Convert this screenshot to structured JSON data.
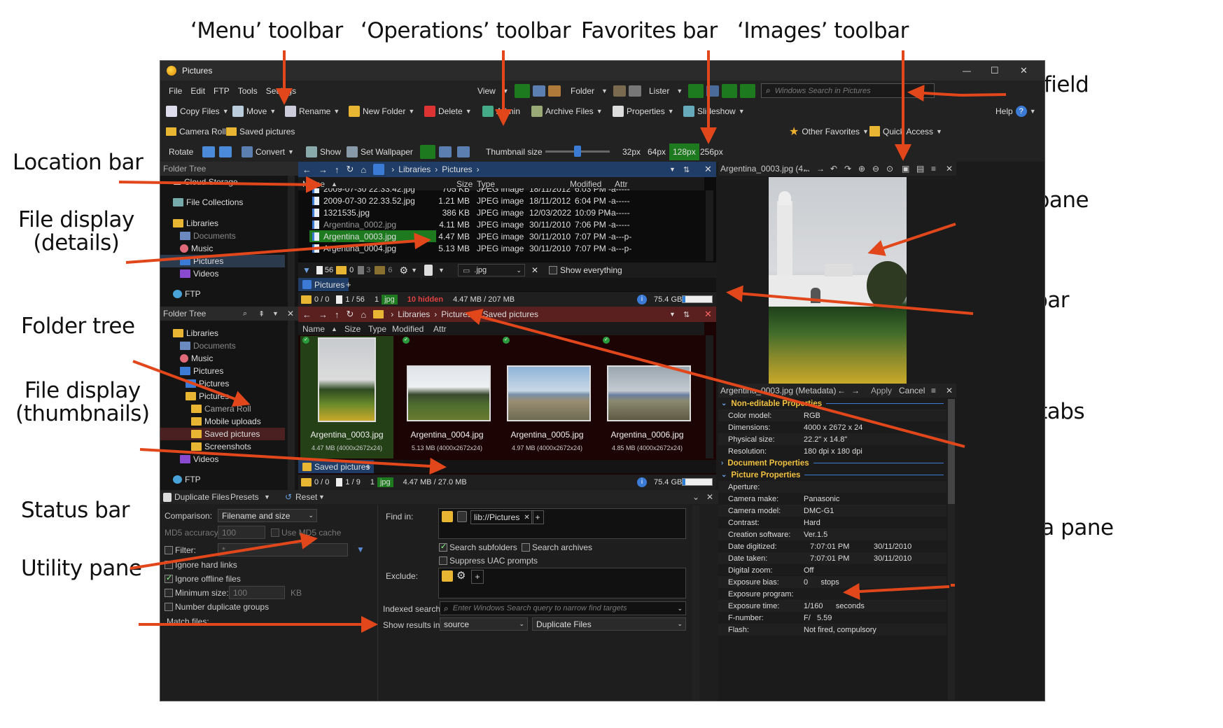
{
  "callouts": {
    "menu_toolbar": "‘Menu’ toolbar",
    "operations_toolbar": "‘Operations’ toolbar",
    "favorites_bar": "Favorites bar",
    "images_toolbar": "‘Images’ toolbar",
    "search_field": "Search field",
    "location_bar": "Location bar",
    "file_display_details_1": "File display",
    "file_display_details_2": "(details)",
    "viewer_pane": "Viewer pane",
    "filter_bar": "Filter bar",
    "folder_tree": "Folder tree",
    "file_display_thumbs_1": "File display",
    "file_display_thumbs_2": "(thumbnails)",
    "folder_tabs": "Folder tabs",
    "status_bar": "Status bar",
    "metadata_pane": "Metadata pane",
    "utility_pane": "Utility pane"
  },
  "window": {
    "title": "Pictures",
    "min_glyph": "—",
    "max_glyph": "☐",
    "close_glyph": "✕"
  },
  "menu": {
    "items": [
      "File",
      "Edit",
      "FTP",
      "Tools",
      "Settings"
    ],
    "view_label": "View",
    "folder_label": "Folder",
    "lister_label": "Lister",
    "search_placeholder": "Windows Search in Pictures"
  },
  "operations": {
    "items": [
      "Copy Files",
      "Move",
      "Rename",
      "New Folder",
      "Delete",
      "Admin",
      "Archive Files",
      "Properties",
      "Slideshow"
    ],
    "help_label": "Help"
  },
  "favorites": {
    "items": [
      "Camera Roll",
      "Saved pictures"
    ],
    "other_favorites": "Other Favorites",
    "quick_access": "Quick Access"
  },
  "images_toolbar": {
    "rotate": "Rotate",
    "convert": "Convert",
    "show": "Show",
    "set_wallpaper": "Set Wallpaper",
    "thumbnail_size": "Thumbnail size",
    "sizes": [
      "32px",
      "64px",
      "128px",
      "256px"
    ],
    "active_size": "128px",
    "slider_fraction": 0.5
  },
  "tree_top": {
    "title": "Folder Tree",
    "items": [
      "Cloud Storage",
      "File Collections",
      "Libraries",
      "Documents",
      "Music",
      "Pictures",
      "Videos",
      "FTP"
    ]
  },
  "tree_bottom": {
    "title": "Folder Tree",
    "items": [
      "Libraries",
      "Documents",
      "Music",
      "Pictures",
      "Pictures",
      "Pictures",
      "Camera Roll",
      "Mobile uploads",
      "Saved pictures",
      "Screenshots",
      "Videos",
      "FTP"
    ]
  },
  "lister_top": {
    "breadcrumb": [
      "Libraries",
      "Pictures"
    ],
    "columns": [
      "Name",
      "Size",
      "Type",
      "Modified",
      "Attr"
    ],
    "rows": [
      {
        "name": "2009-07-30 22.33.42.jpg",
        "size": "705 KB",
        "type": "JPEG image",
        "date": "18/11/2012",
        "time": "6:03 PM",
        "attr": "-a-----"
      },
      {
        "name": "2009-07-30 22.33.52.jpg",
        "size": "1.21 MB",
        "type": "JPEG image",
        "date": "18/11/2012",
        "time": "6:04 PM",
        "attr": "-a-----"
      },
      {
        "name": "1321535.jpg",
        "size": "386 KB",
        "type": "JPEG image",
        "date": "12/03/2022",
        "time": "10:09 PM",
        "attr": "-a-----"
      },
      {
        "name": "Argentina_0002.jpg",
        "size": "4.11 MB",
        "type": "JPEG image",
        "date": "30/11/2010",
        "time": "7:06 PM",
        "attr": "-a-----"
      },
      {
        "name": "Argentina_0003.jpg",
        "size": "4.47 MB",
        "type": "JPEG image",
        "date": "30/11/2010",
        "time": "7:07 PM",
        "attr": "-a---p-"
      },
      {
        "name": "Argentina_0004.jpg",
        "size": "5.13 MB",
        "type": "JPEG image",
        "date": "30/11/2010",
        "time": "7:07 PM",
        "attr": "-a---p-"
      }
    ],
    "filter": {
      "files": "56",
      "folders": "0",
      "hidden_files": "3",
      "hidden_folders": "6",
      "ext": ".jpg",
      "show_everything": "Show everything"
    },
    "tab": "Pictures",
    "status": {
      "folders": "0 / 0",
      "files": "1 / 56",
      "count": "1",
      "ext": "jpg",
      "hidden": "10 hidden",
      "size": "4.47 MB / 207 MB",
      "free": "75.4 GB",
      "free_fraction": 0.1
    }
  },
  "lister_bottom": {
    "breadcrumb": [
      "Libraries",
      "Pictures",
      "Saved pictures"
    ],
    "columns": [
      "Name",
      "Size",
      "Type",
      "Modified",
      "Attr"
    ],
    "thumbs": [
      {
        "name": "Argentina_0003.jpg",
        "info": "4.47 MB (4000x2672x24)"
      },
      {
        "name": "Argentina_0004.jpg",
        "info": "5.13 MB (4000x2672x24)"
      },
      {
        "name": "Argentina_0005.jpg",
        "info": "4.97 MB (4000x2672x24)"
      },
      {
        "name": "Argentina_0006.jpg",
        "info": "4.85 MB (4000x2672x24)"
      }
    ],
    "tab": "Saved pictures",
    "status": {
      "folders": "0 / 0",
      "files": "1 / 9",
      "count": "1",
      "ext": "jpg",
      "size": "4.47 MB / 27.0 MB",
      "free": "75.4 GB",
      "free_fraction": 0.1
    }
  },
  "viewer": {
    "title": "Argentina_0003.jpg (4..."
  },
  "metadata": {
    "title": "Argentina_0003.jpg (Metadata)",
    "apply": "Apply",
    "cancel": "Cancel",
    "sections": {
      "non_editable": "Non-editable Properties",
      "document": "Document Properties",
      "picture": "Picture Properties"
    },
    "non_editable_rows": [
      {
        "k": "Color model:",
        "v": "RGB"
      },
      {
        "k": "Dimensions:",
        "v": "4000 x 2672 x 24"
      },
      {
        "k": "Physical size:",
        "v": "22.2\" x 14.8\""
      },
      {
        "k": "Resolution:",
        "v": "180 dpi x 180 dpi"
      }
    ],
    "picture_rows": [
      {
        "k": "Aperture:",
        "v": "",
        "v2": ""
      },
      {
        "k": "Camera make:",
        "v": "Panasonic",
        "v2": ""
      },
      {
        "k": "Camera model:",
        "v": "DMC-G1",
        "v2": ""
      },
      {
        "k": "Contrast:",
        "v": "Hard",
        "v2": ""
      },
      {
        "k": "Creation software:",
        "v": "Ver.1.5",
        "v2": ""
      },
      {
        "k": "Date digitized:",
        "v": "   7:07:01 PM",
        "v2": "30/11/2010"
      },
      {
        "k": "Date taken:",
        "v": "   7:07:01 PM",
        "v2": "30/11/2010"
      },
      {
        "k": "Digital zoom:",
        "v": "Off",
        "v2": ""
      },
      {
        "k": "Exposure bias:",
        "v": "0      stops",
        "v2": ""
      },
      {
        "k": "Exposure program:",
        "v": "",
        "v2": ""
      },
      {
        "k": "Exposure time:",
        "v": "1/160      seconds",
        "v2": ""
      },
      {
        "k": "F-number:",
        "v": "F/   5.59",
        "v2": ""
      },
      {
        "k": "Flash:",
        "v": "Not fired, compulsory",
        "v2": ""
      }
    ]
  },
  "utility": {
    "title": "Duplicate Files",
    "presets": "Presets",
    "reset": "Reset",
    "comparison_label": "Comparison:",
    "comparison_value": "Filename and size",
    "md5_label": "MD5 accuracy:",
    "md5_value": "100",
    "use_md5": "Use MD5 cache",
    "filter_label": "Filter:",
    "filter_value": "*",
    "ignore_hard": "Ignore hard links",
    "ignore_offline": "Ignore offline files",
    "min_size": "Minimum size:",
    "min_size_value": "100",
    "kb": "KB",
    "number_groups": "Number duplicate groups",
    "match_files": "Match files:",
    "find_in": "Find in:",
    "find_in_value": "lib://Pictures",
    "search_subfolders": "Search subfolders",
    "search_archives": "Search archives",
    "suppress_uac": "Suppress UAC prompts",
    "exclude": "Exclude:",
    "indexed_search": "Indexed search:",
    "indexed_placeholder": "Enter Windows Search query to narrow find targets",
    "show_results": "Show results in:",
    "show_results_value": "source",
    "show_results_value2": "Duplicate Files"
  },
  "colors": {
    "callout_arrow": "#e2471c",
    "selected_green": "#1e7a1e",
    "location_blue": "#1f3d66",
    "location_red": "#5a1f1f",
    "metadata_heading": "#f0c040"
  }
}
